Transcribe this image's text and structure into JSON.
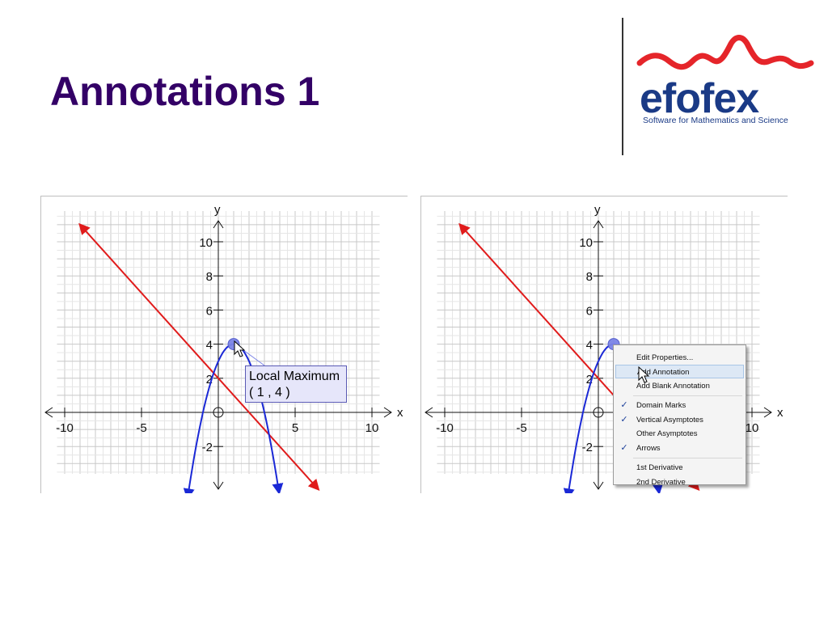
{
  "slide": {
    "title": "Annotations 1"
  },
  "logo": {
    "word": "efofex",
    "tagline": "Software for Mathematics and Science"
  },
  "colors": {
    "title": "#330066",
    "brand_blue": "#1a3a86",
    "brand_red": "#e5252a",
    "curve": "#1a28d6",
    "line": "#e01b1b",
    "point": "#7b84e6",
    "annotation_bg": "#e6e6fa"
  },
  "graph": {
    "axis_x_label": "x",
    "axis_y_label": "y",
    "x_tick_labels": [
      "-10",
      "-5",
      "5",
      "10"
    ],
    "y_tick_labels": [
      "10",
      "8",
      "6",
      "4",
      "2",
      "-2"
    ],
    "origin_label": "O"
  },
  "chart_data": [
    {
      "type": "line",
      "xlim": [
        -11,
        11
      ],
      "ylim": [
        -4.5,
        12.5
      ],
      "grid": true,
      "x_ticks": [
        -10,
        -5,
        5,
        10
      ],
      "y_ticks": [
        10,
        8,
        6,
        4,
        2,
        -2
      ],
      "series": [
        {
          "kind": "parabola",
          "equation_points": [
            [
              -2,
              -5
            ],
            [
              -1,
              0
            ],
            [
              0,
              3
            ],
            [
              1,
              4
            ],
            [
              2,
              3
            ],
            [
              3,
              0
            ],
            [
              4,
              -5
            ]
          ]
        },
        {
          "kind": "line",
          "x": [
            -9,
            6.5
          ],
          "y": [
            11,
            -4.5
          ]
        }
      ],
      "marked_point": [
        1,
        4
      ],
      "annotation": [
        "Local Maximum",
        "( 1 , 4 )"
      ]
    },
    {
      "type": "line",
      "xlim": [
        -11,
        11
      ],
      "ylim": [
        -4.5,
        12.5
      ],
      "grid": true,
      "x_ticks": [
        -10,
        -5,
        5,
        10
      ],
      "y_ticks": [
        10,
        8,
        6,
        4,
        2,
        -2
      ],
      "series": [
        {
          "kind": "parabola",
          "equation_points": [
            [
              -2,
              -5
            ],
            [
              -1,
              0
            ],
            [
              0,
              3
            ],
            [
              1,
              4
            ],
            [
              2,
              3
            ],
            [
              3,
              0
            ],
            [
              4,
              -5
            ]
          ]
        },
        {
          "kind": "line",
          "x": [
            -9,
            6.5
          ],
          "y": [
            11,
            -4.5
          ]
        }
      ],
      "marked_point": [
        1,
        4
      ]
    }
  ],
  "left_panel": {
    "annotation": {
      "line1": "Local Maximum",
      "line2": "( 1 , 4 )"
    }
  },
  "context_menu": {
    "items": [
      {
        "label": "Edit Properties...",
        "checked": false
      },
      {
        "label": "Add Annotation",
        "checked": false,
        "highlighted": true
      },
      {
        "label": "Add Blank Annotation",
        "checked": false
      },
      {
        "label": "Domain Marks",
        "checked": true
      },
      {
        "label": "Vertical Asymptotes",
        "checked": true
      },
      {
        "label": "Other Asymptotes",
        "checked": false
      },
      {
        "label": "Arrows",
        "checked": true
      },
      {
        "label": "1st Derivative",
        "checked": false
      },
      {
        "label": "2nd Derivative",
        "checked": false
      }
    ],
    "check_glyph": "✓"
  }
}
